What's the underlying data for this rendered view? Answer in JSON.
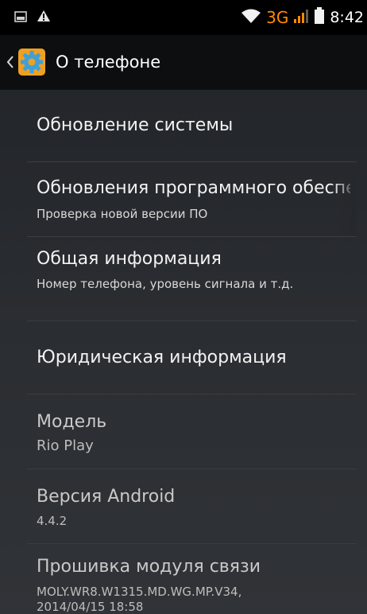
{
  "status_bar": {
    "network_type": "3G",
    "time": "8:42",
    "icons": [
      "screenshot-icon",
      "warning-icon",
      "wifi-icon",
      "signal-icon",
      "battery-icon"
    ],
    "network_color": "#ff8a00"
  },
  "action_bar": {
    "title": "О телефоне",
    "icons": [
      "back-chevron-icon",
      "settings-gear-icon"
    ],
    "icon_color": "#f0a020"
  },
  "items": [
    {
      "title": "Обновление системы",
      "summary": ""
    },
    {
      "title": "Обновления программного обеспечения",
      "summary": "Проверка новой версии ПО"
    },
    {
      "title": "Общая информация",
      "summary": "Номер телефона, уровень сигнала и т.д."
    },
    {
      "title": "Юридическая информация",
      "summary": ""
    },
    {
      "title": "Модель",
      "summary": "Rio Play"
    },
    {
      "title": "Версия Android",
      "summary": "4.4.2"
    },
    {
      "title": "Прошивка модуля связи",
      "summary": "MOLY.WR8.W1315.MD.WG.MP.V34, 2014/04/15 18:58"
    }
  ]
}
